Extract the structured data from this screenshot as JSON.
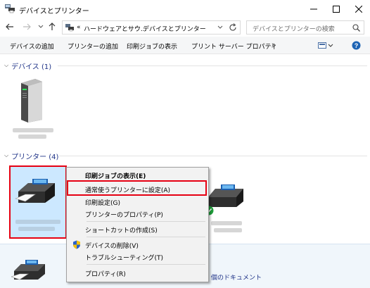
{
  "window": {
    "title": "デバイスとプリンター"
  },
  "address": {
    "chevron": "«",
    "crumbs": [
      "ハードウェアとサウ...",
      "デバイスとプリンター"
    ],
    "search_placeholder": "デバイスとプリンターの検索"
  },
  "toolbar": {
    "items": [
      "デバイスの追加",
      "プリンターの追加",
      "印刷ジョブの表示",
      "プリント サーバー プロパティ"
    ],
    "more": "»"
  },
  "devices": {
    "header": "デバイス (1)"
  },
  "printers": {
    "header": "プリンター (4)"
  },
  "details": {
    "documents": "個のドキュメント"
  },
  "context_menu": {
    "items": [
      {
        "label": "印刷ジョブの表示(E)",
        "bold": true
      },
      {
        "label": "通常使うプリンターに設定(A)"
      },
      {
        "label": "印刷設定(G)"
      },
      {
        "label": "プリンターのプロパティ(P)"
      },
      {
        "label": "ショートカットの作成(S)"
      },
      {
        "label": "デバイスの削除(V)",
        "icon": "shield-icon"
      },
      {
        "label": "トラブルシューティング(T)"
      },
      {
        "label": "プロパティ(R)"
      }
    ]
  },
  "colors": {
    "highlight": "#e60012",
    "header_text": "#1e3287",
    "check_green": "#1e9e3a"
  }
}
